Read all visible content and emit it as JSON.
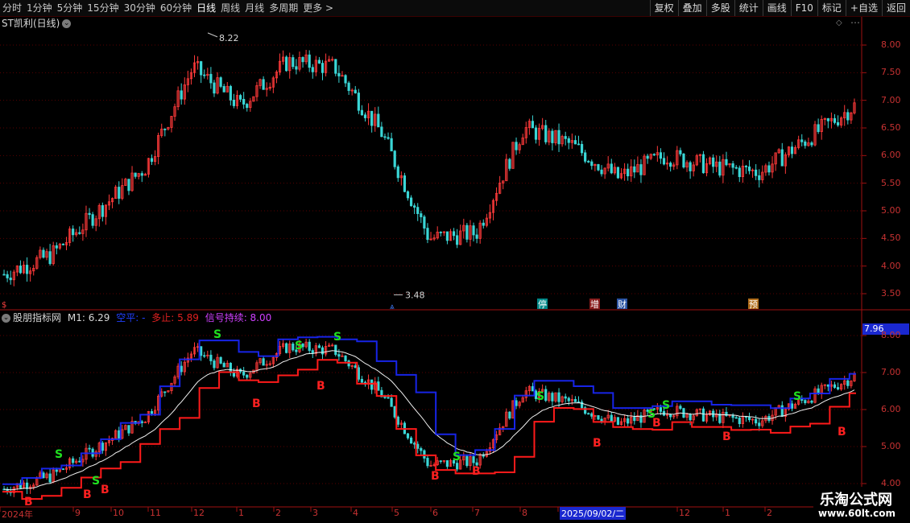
{
  "toolbar": {
    "periods": [
      "分时",
      "1分钟",
      "5分钟",
      "15分钟",
      "30分钟",
      "60分钟",
      "日线",
      "周线",
      "月线",
      "多周期",
      "更多"
    ],
    "active_period": "日线",
    "buttons": [
      "复权",
      "叠加",
      "多股",
      "统计",
      "画线",
      "F10",
      "标记",
      "+自选",
      "返回"
    ]
  },
  "main_title": "ST凯利(日线)",
  "price_axis": [
    "8.00",
    "7.50",
    "7.00",
    "6.50",
    "6.00",
    "5.50",
    "5.00",
    "4.50",
    "4.00",
    "3.50"
  ],
  "high_marker": "8.22",
  "low_marker": "3.48",
  "event_markers": [
    {
      "label": "停",
      "color": "#00a0a0"
    },
    {
      "label": "增",
      "color": "#a02020"
    },
    {
      "label": "财",
      "color": "#3060c0"
    },
    {
      "label": "预",
      "color": "#d08020"
    }
  ],
  "indicator": {
    "name": "股朋指标网",
    "m1_label": "M1: 6.29",
    "kongping_label": "空平: -",
    "duozhi_label": "多止: 5.89",
    "signal_label": "信号持续: 8.00",
    "current_value_box": "7.96",
    "axis": [
      "8.00",
      "7.00",
      "6.00",
      "5.00",
      "4.00"
    ]
  },
  "signals": {
    "buy_label": "B",
    "sell_label": "S"
  },
  "date_axis": [
    "2024年",
    "9",
    "10",
    "11",
    "12",
    "1",
    "2",
    "3",
    "4",
    "5",
    "6",
    "7",
    "8",
    "2025/09/02/二",
    "12",
    "1",
    "2"
  ],
  "watermark": {
    "line1": "乐淘公式网",
    "line2": "www.60lt.com"
  },
  "chart_data": {
    "type": "candlestick",
    "title": "ST凯利(日线)",
    "y_range": [
      3.3,
      8.4
    ],
    "x_range": [
      "2024-08",
      "2026-02"
    ],
    "price_trajectory": [
      {
        "period": "2024-08",
        "close": 3.85
      },
      {
        "period": "2024-09",
        "close": 4.2
      },
      {
        "period": "2024-10",
        "close": 5.0
      },
      {
        "period": "2024-11",
        "close": 5.8
      },
      {
        "period": "2024-12",
        "close": 7.6
      },
      {
        "period": "2025-01",
        "close": 6.9
      },
      {
        "period": "2025-02",
        "close": 7.7
      },
      {
        "period": "2025-03",
        "close": 7.6
      },
      {
        "period": "2025-04",
        "close": 6.4
      },
      {
        "period": "2025-05",
        "close": 4.5
      },
      {
        "period": "2025-06",
        "close": 4.6
      },
      {
        "period": "2025-07",
        "close": 6.5
      },
      {
        "period": "2025-08",
        "close": 6.2
      },
      {
        "period": "2025-09",
        "close": 5.6
      },
      {
        "period": "2025-10",
        "close": 6.0
      },
      {
        "period": "2025-11",
        "close": 5.8
      },
      {
        "period": "2025-12",
        "close": 5.7
      },
      {
        "period": "2026-01",
        "close": 6.3
      },
      {
        "period": "2026-02",
        "close": 6.9
      }
    ],
    "high": 8.22,
    "low": 3.48
  }
}
